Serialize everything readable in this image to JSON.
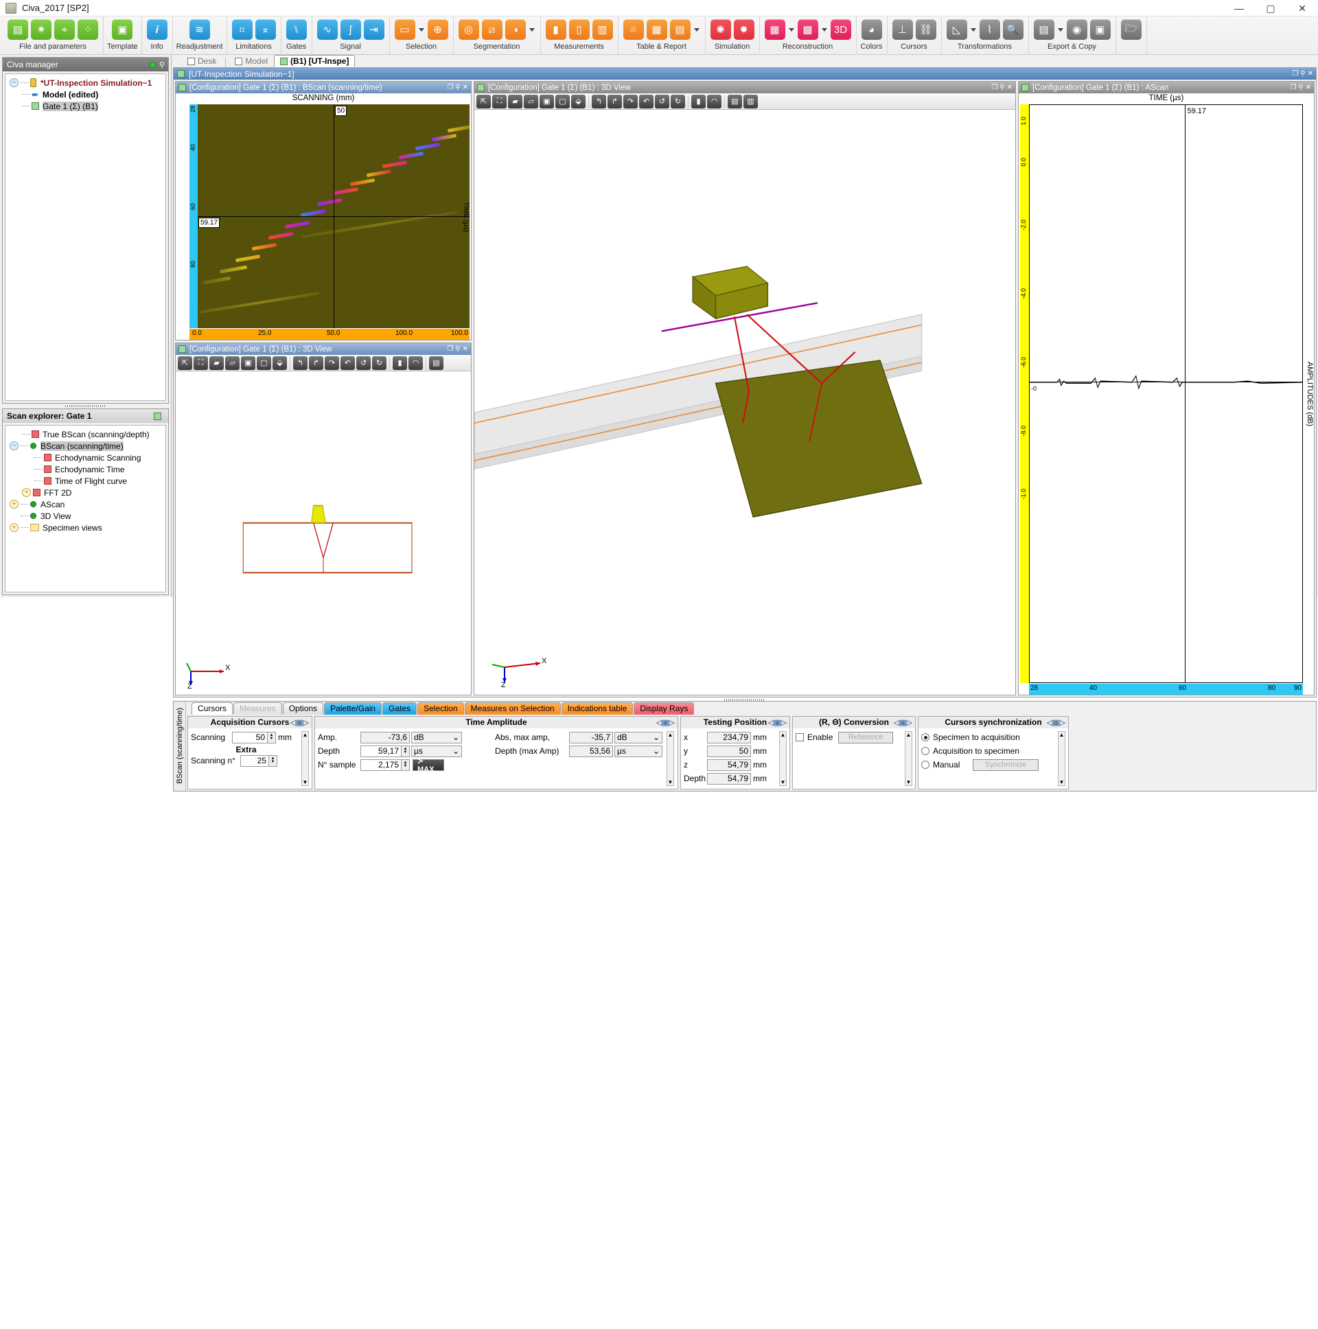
{
  "window": {
    "title": "Civa_2017 [SP2]",
    "minimize": "—",
    "maximize": "▢",
    "close": "✕"
  },
  "ribbon": {
    "groups": [
      {
        "label": "File and parameters",
        "icons": [
          "layers-icon",
          "gear-icon",
          "location-pin-icon",
          "nodes-icon"
        ]
      },
      {
        "label": "Template",
        "icons": [
          "bookmark-icon"
        ]
      },
      {
        "label": "Info",
        "icons": [
          "info-icon"
        ]
      },
      {
        "label": "Readjustment",
        "icons": [
          "readjust-icon"
        ]
      },
      {
        "label": "Limitations",
        "icons": [
          "crop-icon",
          "crop-arrow-icon"
        ]
      },
      {
        "label": "Gates",
        "icons": [
          "gate-icon"
        ]
      },
      {
        "label": "Signal",
        "icons": [
          "waveform-icon",
          "integral-icon",
          "step-signal-icon"
        ]
      },
      {
        "label": "Selection",
        "icons": [
          "rect-select-icon",
          "add-select-icon"
        ]
      },
      {
        "label": "Segmentation",
        "icons": [
          "contour-icon",
          "hatch-icon",
          "split-icon"
        ]
      },
      {
        "label": "Measurements",
        "icons": [
          "ruler-icon",
          "ruler-add-icon",
          "bars-icon"
        ]
      },
      {
        "label": "Table & Report",
        "icons": [
          "camera-add-icon",
          "table-icon",
          "report-icon"
        ]
      },
      {
        "label": "Simulation",
        "icons": [
          "sim-icon",
          "percent-icon"
        ]
      },
      {
        "label": "Reconstruction",
        "icons": [
          "grid-icon",
          "matrix-icon",
          "recon3d-icon"
        ]
      },
      {
        "label": "Colors",
        "icons": [
          "palette-icon"
        ]
      },
      {
        "label": "Cursors",
        "icons": [
          "cursor1-icon",
          "link-icon"
        ]
      },
      {
        "label": "Transformations",
        "icons": [
          "mirror-icon",
          "transform-icon",
          "zoom-icon"
        ]
      },
      {
        "label": "Export & Copy",
        "icons": [
          "export-icon",
          "camera-icon",
          "dxf-icon"
        ]
      },
      {
        "label": "",
        "icons": [
          "open-folder-icon"
        ]
      }
    ]
  },
  "civa_manager": {
    "title": "Civa manager",
    "tree": [
      {
        "label": "*UT-Inspection Simulation~1",
        "level": 0,
        "icon": "cylinder-icon",
        "expander": "minus",
        "style": "red"
      },
      {
        "label": "Model (edited)",
        "level": 1,
        "icon": "arrow-icon",
        "style": "bold"
      },
      {
        "label": "Gate 1 (Σ) (B1)",
        "level": 1,
        "icon": "green-square-icon",
        "selected": true
      }
    ]
  },
  "scan_explorer": {
    "title": "Scan explorer: Gate 1",
    "tree": [
      {
        "label": "True BScan (scanning/depth)",
        "level": 1,
        "icon": "red-square-icon"
      },
      {
        "label": "BScan (scanning/time)",
        "level": 1,
        "icon": "green-dot-icon",
        "expander": "minus",
        "selected": true
      },
      {
        "label": "Echodynamic Scanning",
        "level": 2,
        "icon": "red-square-icon"
      },
      {
        "label": "Echodynamic Time",
        "level": 2,
        "icon": "red-square-icon"
      },
      {
        "label": "Time of Flight curve",
        "level": 2,
        "icon": "red-square-icon"
      },
      {
        "label": "FFT 2D",
        "level": 2,
        "icon": "red-square-icon",
        "expander": "plus"
      },
      {
        "label": "AScan",
        "level": 1,
        "icon": "green-dot-icon",
        "expander": "plus"
      },
      {
        "label": "3D View",
        "level": 1,
        "icon": "green-dot-icon"
      },
      {
        "label": "Specimen views",
        "level": 1,
        "icon": "folder-icon",
        "expander": "plus"
      }
    ]
  },
  "doc_tabs": [
    {
      "label": "Desk",
      "icon": "desk-icon",
      "active": false
    },
    {
      "label": "Model",
      "icon": "model-icon",
      "active": false
    },
    {
      "label": "(B1) [UT-Inspe]",
      "icon": "gate-icon",
      "active": true
    }
  ],
  "mdi": {
    "title": "[UT-Inspection Simulation~1]",
    "restore": "❐",
    "pin": "⚲",
    "close": "✕"
  },
  "panels": {
    "bscan": {
      "title": "[Configuration] Gate 1 (Σ) (B1) : BScan (scanning/time)"
    },
    "view3d_small": {
      "title": "[Configuration] Gate 1 (Σ) (B1) : 3D View"
    },
    "view3d_big": {
      "title": "[Configuration] Gate 1 (Σ) (B1) : 3D View"
    },
    "ascan": {
      "title": "[Configuration] Gate 1 (Σ) (B1) : AScan"
    }
  },
  "view3d_toolbar": [
    "pointer-icon",
    "fit-screen-icon",
    "solid-box-icon",
    "shaded-box-icon",
    "wire-box-icon",
    "transparent-box-icon",
    "explode-icon",
    "rotate-up-icon",
    "rotate-down-icon",
    "rotate-right-icon",
    "rotate-left-icon",
    "rotate-ccw-icon",
    "rotate-cw-icon",
    "ruler-icon",
    "protractor-icon",
    "frame-icon",
    "layers-icon"
  ],
  "chart_data": [
    {
      "type": "heatmap",
      "title": "SCANNING (mm)",
      "xlabel": "SCANNING (mm)",
      "ylabel": "TIME (µs)",
      "xlim": [
        0.0,
        100.0
      ],
      "ylim": [
        28,
        90
      ],
      "xticks": [
        "0.0",
        "25.0",
        "50.0",
        "100.0"
      ],
      "yticks": [
        "28",
        "40",
        "60",
        "80"
      ],
      "cursor_x_value": "50",
      "cursor_y_value": "59.17",
      "grid": false,
      "legend": "none",
      "notes": "Diagonal high-amplitude echo band rising from lower-left to upper-right on dark olive background"
    },
    {
      "type": "line",
      "title": "TIME (µs)",
      "xlabel": "TIME (µs)",
      "ylabel": "AMPLITUDES (dB)",
      "xlim": [
        28,
        90
      ],
      "ylim": [
        -6.0,
        1.0
      ],
      "xticks": [
        "28",
        "40",
        "60",
        "80",
        "90"
      ],
      "yticks": [
        "1.0",
        "0.0",
        "-2.0",
        "-4.0",
        "-6.0",
        "-8.0",
        "-1.0"
      ],
      "cursor_x_value": "59.17",
      "grid": false,
      "legend": "none",
      "values": []
    }
  ],
  "bottom_tabs": [
    {
      "label": "Cursors",
      "state": "active"
    },
    {
      "label": "Measures",
      "state": "disabled"
    },
    {
      "label": "Options",
      "state": "normal"
    },
    {
      "label": "Palette/Gain",
      "state": "blue"
    },
    {
      "label": "Gates",
      "state": "blue"
    },
    {
      "label": "Selection",
      "state": "orange"
    },
    {
      "label": "Measures on Selection",
      "state": "orange"
    },
    {
      "label": "Indications table",
      "state": "orange"
    },
    {
      "label": "Display Rays",
      "state": "red"
    }
  ],
  "side_tab_label": "BScan (scanning/time)",
  "acquisition_cursors": {
    "title": "Acquisition Cursors",
    "scanning_label": "Scanning",
    "scanning_value": "50",
    "scanning_unit": "mm",
    "extra_label": "Extra",
    "scanning_no_label": "Scanning n°",
    "scanning_no_value": "25"
  },
  "time_amplitude": {
    "title": "Time Amplitude",
    "amp_label": "Amp.",
    "amp_value": "-73,6",
    "amp_unit": "dB",
    "depth_label": "Depth",
    "depth_value": "59,17",
    "depth_unit": "µs",
    "nsample_label": "N° sample",
    "nsample_value": "2,175",
    "max_button": "≻ MAX",
    "abs_max_label": "Abs, max amp,",
    "abs_max_value": "-35,7",
    "abs_max_unit": "dB",
    "depth_max_label": "Depth (max Amp)",
    "depth_max_value": "53,56",
    "depth_max_unit": "µs"
  },
  "testing_position": {
    "title": "Testing Position",
    "rows": [
      {
        "label": "x",
        "value": "234,79",
        "unit": "mm"
      },
      {
        "label": "y",
        "value": "50",
        "unit": "mm"
      },
      {
        "label": "z",
        "value": "54,79",
        "unit": "mm"
      },
      {
        "label": "Depth",
        "value": "54,79",
        "unit": "mm"
      }
    ]
  },
  "r_theta_conversion": {
    "title": "(R, Θ) Conversion",
    "enable_label": "Enable",
    "reference_button": "Reference"
  },
  "cursors_sync": {
    "title": "Cursors synchronization",
    "options": [
      {
        "label": "Specimen to acquisition",
        "selected": true
      },
      {
        "label": "Acquisition to specimen",
        "selected": false
      },
      {
        "label": "Manual",
        "selected": false
      }
    ],
    "synchronize_button": "Synchronize"
  },
  "colors": {
    "accent_blue": "#2ec8f5",
    "axis_orange": "#ffa500",
    "axis_yellow": "#ffff00",
    "bscan_bg": "#55510a",
    "titlebar_blue": "#5280b5"
  }
}
